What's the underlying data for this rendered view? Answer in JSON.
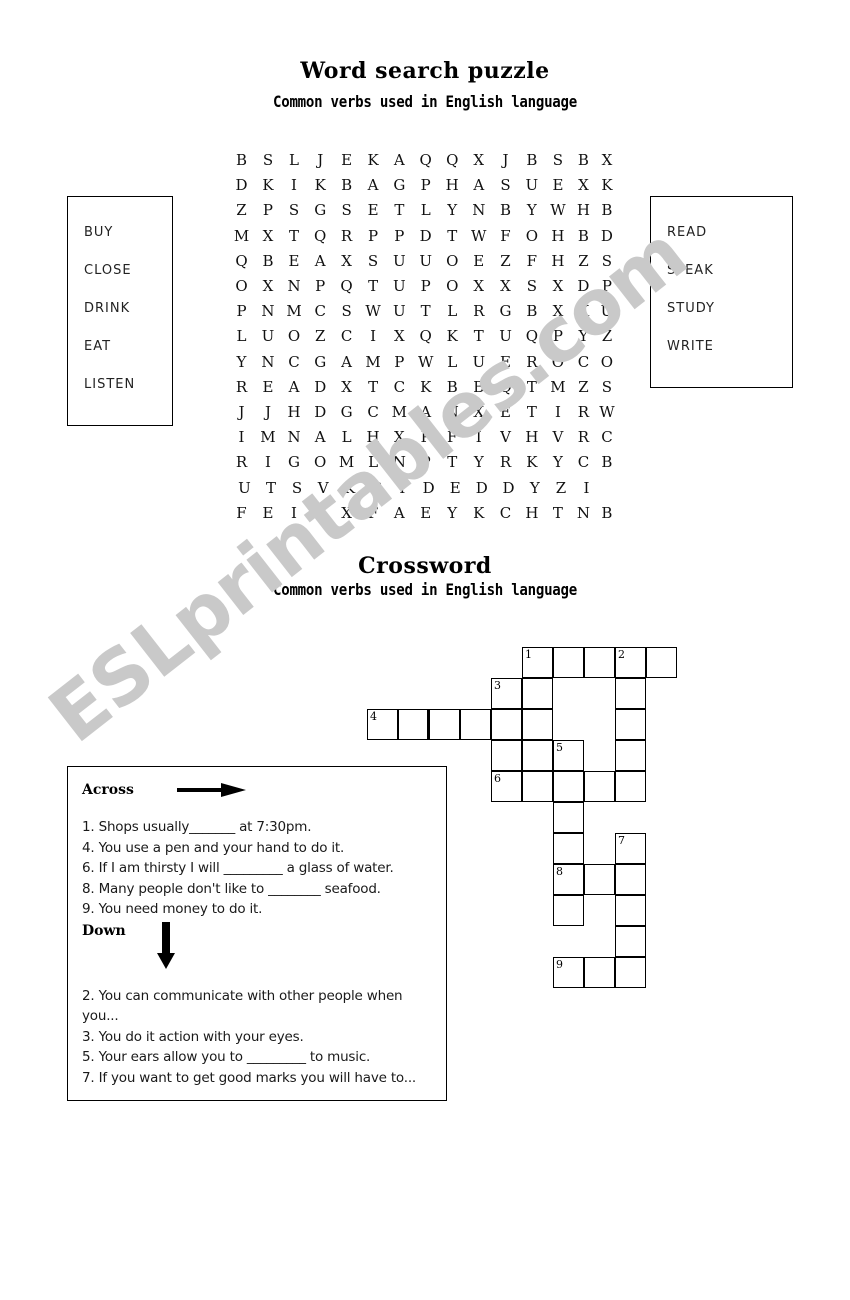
{
  "wordsearch": {
    "title": "Word search puzzle",
    "subtitle": "Common verbs used in English language",
    "grid": [
      [
        "B",
        "S",
        "L",
        "J",
        "E",
        "K",
        "A",
        "Q",
        "Q",
        "X",
        "J",
        "B",
        "S",
        "B",
        "X"
      ],
      [
        "D",
        "K",
        "I",
        "K",
        "B",
        "A",
        "G",
        "P",
        "H",
        "A",
        "S",
        "U",
        "E",
        "X",
        "K"
      ],
      [
        "Z",
        "P",
        "S",
        "G",
        "S",
        "E",
        "T",
        "L",
        "Y",
        "N",
        "B",
        "Y",
        "W",
        "H",
        "B"
      ],
      [
        "M",
        "X",
        "T",
        "Q",
        "R",
        "P",
        "P",
        "D",
        "T",
        "W",
        "F",
        "O",
        "H",
        "B",
        "D"
      ],
      [
        "Q",
        "B",
        "E",
        "A",
        "X",
        "S",
        "U",
        "U",
        "O",
        "E",
        "Z",
        "F",
        "H",
        "Z",
        "S"
      ],
      [
        "O",
        "X",
        "N",
        "P",
        "Q",
        "T",
        "U",
        "P",
        "O",
        "X",
        "X",
        "S",
        "X",
        "D",
        "P"
      ],
      [
        "P",
        "N",
        "M",
        "C",
        "S",
        "W",
        "U",
        "T",
        "L",
        "R",
        "G",
        "B",
        "X",
        "K",
        "U"
      ],
      [
        "L",
        "U",
        "O",
        "Z",
        "C",
        "I",
        "X",
        "Q",
        "K",
        "T",
        "U",
        "Q",
        "P",
        "Y",
        "Z"
      ],
      [
        "Y",
        "N",
        "C",
        "G",
        "A",
        "M",
        "P",
        "W",
        "L",
        "U",
        "E",
        "R",
        "O",
        "C",
        "O"
      ],
      [
        "R",
        "E",
        "A",
        "D",
        "X",
        "T",
        "C",
        "K",
        "B",
        "B",
        "Q",
        "T",
        "M",
        "Z",
        "S"
      ],
      [
        "J",
        "J",
        "H",
        "D",
        "G",
        "C",
        "M",
        "A",
        "N",
        "X",
        "E",
        "T",
        "I",
        "R",
        "W"
      ],
      [
        "I",
        "M",
        "N",
        "A",
        "L",
        "H",
        "X",
        "P",
        "F",
        "I",
        "V",
        "H",
        "V",
        "R",
        "C"
      ],
      [
        "R",
        "I",
        "G",
        "O",
        "M",
        "L",
        "N",
        "P",
        "T",
        "Y",
        "R",
        "K",
        "Y",
        "C",
        "B"
      ],
      [
        "U",
        "T",
        "S",
        "V",
        "K",
        "C",
        "Y",
        "D",
        "E",
        "D",
        "D",
        "Y",
        "Z",
        "I"
      ],
      [
        "F",
        "E",
        "I",
        "E",
        "X",
        "F",
        "A",
        "E",
        "Y",
        "K",
        "C",
        "H",
        "T",
        "N",
        "B"
      ]
    ],
    "words_left": [
      "BUY",
      "CLOSE",
      "DRINK",
      "EAT",
      "LISTEN"
    ],
    "words_right": [
      "READ",
      "SPEAK",
      "STUDY",
      "WRITE"
    ]
  },
  "crossword": {
    "title": "Crossword",
    "subtitle": "Common verbs used in English language",
    "across_label": "Across",
    "down_label": "Down",
    "across_clues": [
      "1. Shops usually_______ at 7:30pm.",
      "4. You use a pen and your hand to do it.",
      "6. If I am thirsty I will _________ a glass of water.",
      "8. Many people don't like to ________ seafood.",
      "9. You need money to do it."
    ],
    "down_clues": [
      "2. You can communicate with other people when you...",
      "3. You do it action with your eyes.",
      "5. Your ears allow you to _________ to music.",
      "7. If you want to get good marks you will have to..."
    ],
    "cells": [
      {
        "col": 5,
        "row": 0,
        "num": "1"
      },
      {
        "col": 6,
        "row": 0,
        "num": ""
      },
      {
        "col": 7,
        "row": 0,
        "num": ""
      },
      {
        "col": 8,
        "row": 0,
        "num": "2"
      },
      {
        "col": 9,
        "row": 0,
        "num": ""
      },
      {
        "col": 4,
        "row": 1,
        "num": "3"
      },
      {
        "col": 5,
        "row": 1,
        "num": ""
      },
      {
        "col": 8,
        "row": 1,
        "num": ""
      },
      {
        "col": 0,
        "row": 2,
        "num": "4",
        "thick": false
      },
      {
        "col": 1,
        "row": 2,
        "num": "",
        "thick": true
      },
      {
        "col": 2,
        "row": 2,
        "num": ""
      },
      {
        "col": 3,
        "row": 2,
        "num": ""
      },
      {
        "col": 4,
        "row": 2,
        "num": ""
      },
      {
        "col": 5,
        "row": 2,
        "num": ""
      },
      {
        "col": 8,
        "row": 2,
        "num": ""
      },
      {
        "col": 4,
        "row": 3,
        "num": ""
      },
      {
        "col": 5,
        "row": 3,
        "num": ""
      },
      {
        "col": 6,
        "row": 3,
        "num": "5"
      },
      {
        "col": 8,
        "row": 3,
        "num": ""
      },
      {
        "col": 4,
        "row": 4,
        "num": "6"
      },
      {
        "col": 5,
        "row": 4,
        "num": ""
      },
      {
        "col": 6,
        "row": 4,
        "num": ""
      },
      {
        "col": 7,
        "row": 4,
        "num": ""
      },
      {
        "col": 8,
        "row": 4,
        "num": ""
      },
      {
        "col": 6,
        "row": 5,
        "num": ""
      },
      {
        "col": 6,
        "row": 6,
        "num": ""
      },
      {
        "col": 8,
        "row": 6,
        "num": "7"
      },
      {
        "col": 6,
        "row": 7,
        "num": "8"
      },
      {
        "col": 7,
        "row": 7,
        "num": ""
      },
      {
        "col": 8,
        "row": 7,
        "num": ""
      },
      {
        "col": 6,
        "row": 8,
        "num": ""
      },
      {
        "col": 8,
        "row": 8,
        "num": ""
      },
      {
        "col": 8,
        "row": 9,
        "num": ""
      },
      {
        "col": 6,
        "row": 10,
        "num": "9"
      },
      {
        "col": 7,
        "row": 10,
        "num": ""
      },
      {
        "col": 8,
        "row": 10,
        "num": ""
      }
    ]
  },
  "watermark": {
    "text": "ESLprintables.com"
  }
}
